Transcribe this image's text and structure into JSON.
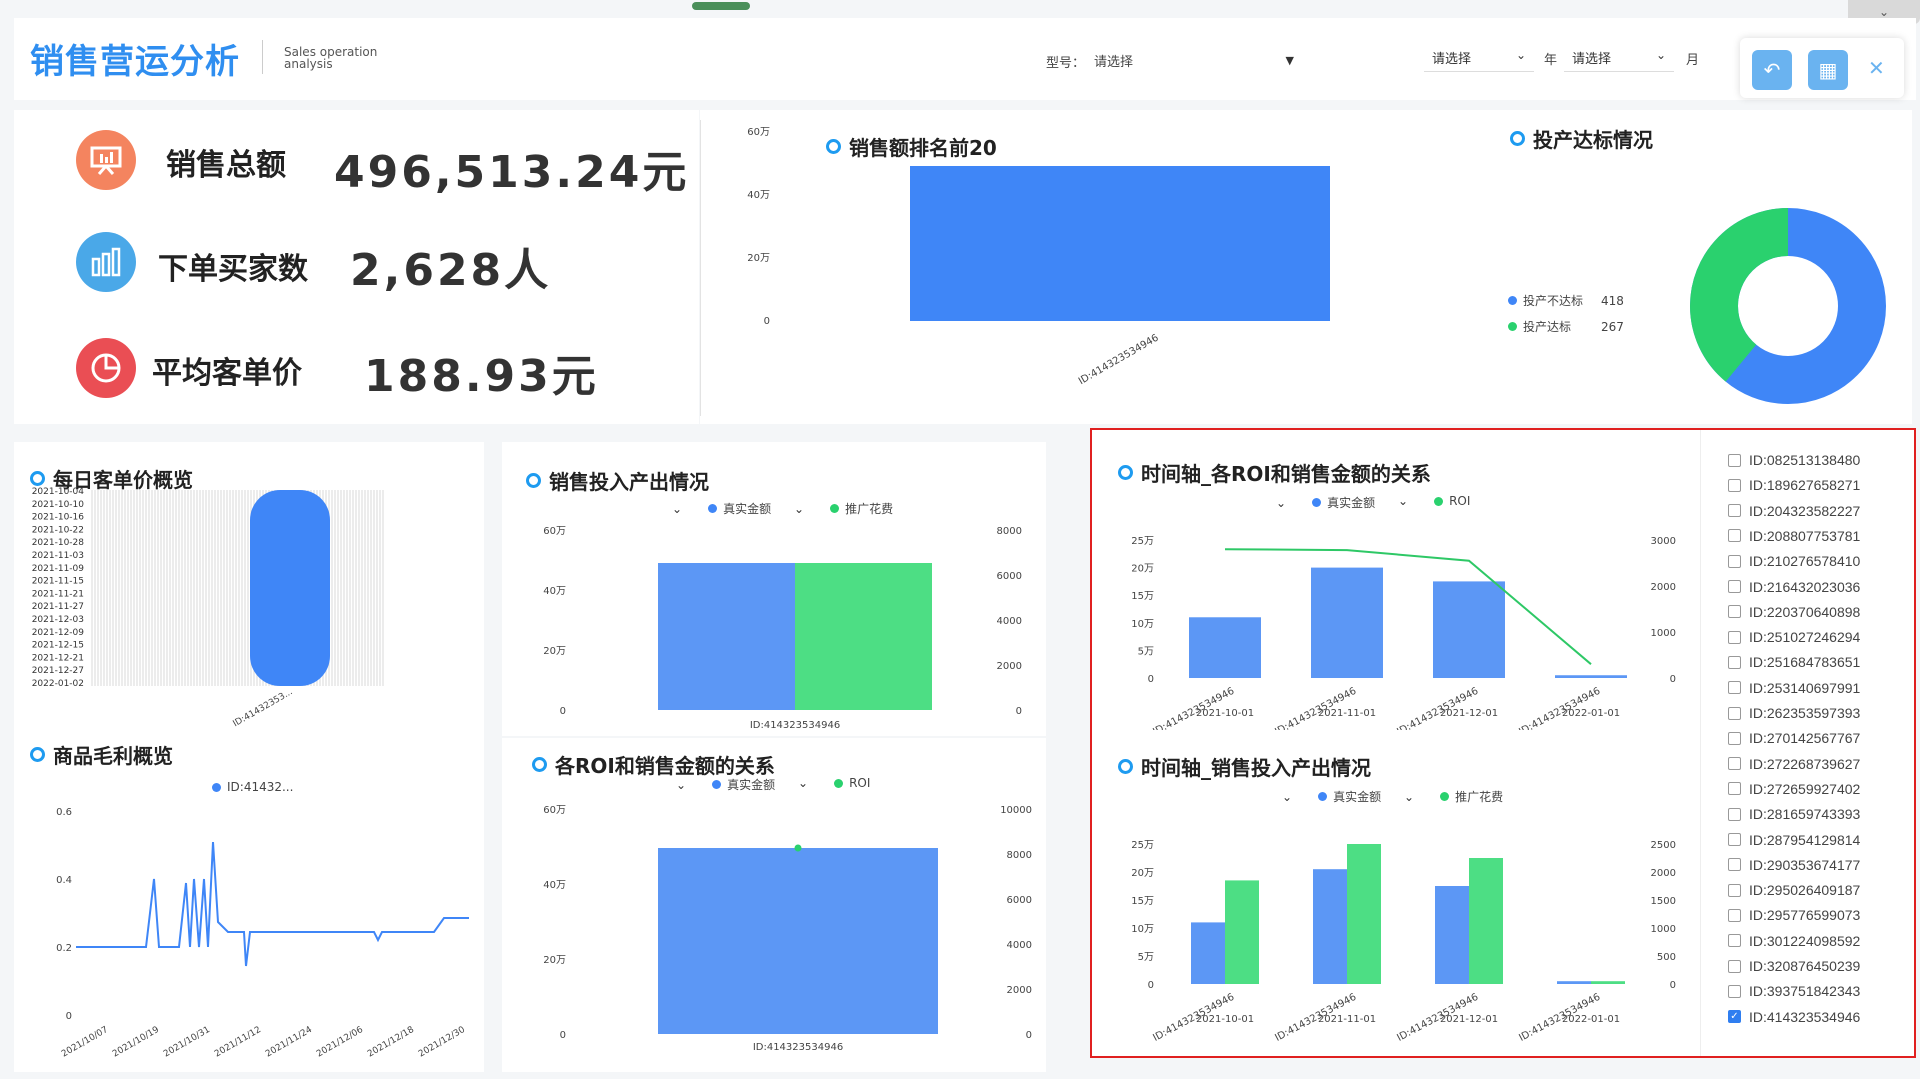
{
  "header": {
    "title": "销售营运分析",
    "subtitle_line1": "Sales operation",
    "subtitle_line2": "analysis",
    "model_label": "型号：",
    "model_value": "请选择",
    "year_select": "请选择",
    "year_label": "年",
    "month_select": "请选择",
    "month_label": "月"
  },
  "kpis": [
    {
      "label": "销售总额",
      "value": "496,513.24元",
      "icon": "presentation-icon",
      "color": "#f4845f"
    },
    {
      "label": "下单买家数",
      "value": "2,628人",
      "icon": "bar-chart-icon",
      "color": "#4aa8e8"
    },
    {
      "label": "平均客单价",
      "value": "188.93元",
      "icon": "pie-chart-icon",
      "color": "#ea4e54"
    }
  ],
  "colors": {
    "blue": "#3f86f7",
    "green": "#2ad16e",
    "line_green": "#2ec866",
    "accent": "#1e9bf0",
    "highlight_border": "#e02020"
  },
  "charts": {
    "top20": {
      "title": "销售额排名前20",
      "yticks": [
        "60万",
        "40万",
        "20万",
        "0"
      ],
      "xtick": "ID:414323534946"
    },
    "roi_pie": {
      "title": "投产达标情况",
      "legend": [
        {
          "name": "投产不达标",
          "value": "418"
        },
        {
          "name": "投产达标",
          "value": "267"
        }
      ]
    },
    "daily_unit": {
      "title": "每日客单价概览",
      "dates": [
        "2021-10-04",
        "2021-10-10",
        "2021-10-16",
        "2021-10-22",
        "2021-10-28",
        "2021-11-03",
        "2021-11-09",
        "2021-11-15",
        "2021-11-21",
        "2021-11-27",
        "2021-12-03",
        "2021-12-09",
        "2021-12-15",
        "2021-12-21",
        "2021-12-27",
        "2022-01-02"
      ],
      "xtick": "ID:41432353..."
    },
    "margin": {
      "title": "商品毛利概览",
      "legend": "ID:41432...",
      "yticks": [
        "0.6",
        "0.4",
        "0.2",
        "0"
      ],
      "xticks": [
        "2021/10/07",
        "2021/10/19",
        "2021/10/31",
        "2021/11/12",
        "2021/11/24",
        "2021/12/06",
        "2021/12/18",
        "2021/12/30"
      ]
    },
    "input_output": {
      "title": "销售投入产出情况",
      "legend": [
        "真实金额",
        "推广花费"
      ],
      "yticks_left": [
        "60万",
        "40万",
        "20万",
        "0"
      ],
      "yticks_right": [
        "8000",
        "6000",
        "4000",
        "2000",
        "0"
      ],
      "xtick": "ID:414323534946"
    },
    "roi_sales": {
      "title": "各ROI和销售金额的关系",
      "legend": [
        "真实金额",
        "ROI"
      ],
      "yticks_left": [
        "60万",
        "40万",
        "20万",
        "0"
      ],
      "yticks_right": [
        "10000",
        "8000",
        "6000",
        "4000",
        "2000",
        "0"
      ],
      "xtick": "ID:414323534946"
    },
    "timeline_roi": {
      "title": "时间轴_各ROI和销售金额的关系",
      "legend": [
        "真实金额",
        "ROI"
      ],
      "yticks_left": [
        "25万",
        "20万",
        "15万",
        "10万",
        "5万",
        "0"
      ],
      "yticks_right": [
        "3000",
        "2000",
        "1000",
        "0"
      ],
      "xtick_id": "ID:414323534946",
      "xdates": [
        "2021-10-01",
        "2021-11-01",
        "2021-12-01",
        "2022-01-01"
      ]
    },
    "timeline_io": {
      "title": "时间轴_销售投入产出情况",
      "legend": [
        "真实金额",
        "推广花费"
      ],
      "yticks_left": [
        "25万",
        "20万",
        "15万",
        "10万",
        "5万",
        "0"
      ],
      "yticks_right": [
        "2500",
        "2000",
        "1500",
        "1000",
        "500",
        "0"
      ],
      "xtick_id": "ID:414323534946",
      "xdates": [
        "2021-10-01",
        "2021-11-01",
        "2021-12-01",
        "2022-01-01"
      ]
    }
  },
  "chart_data": [
    {
      "type": "bar",
      "title": "销售额排名前20",
      "categories": [
        "ID:414323534946"
      ],
      "values": [
        500000
      ],
      "ylim": [
        0,
        600000
      ]
    },
    {
      "type": "pie",
      "title": "投产达标情况",
      "labels": [
        "投产不达标",
        "投产达标"
      ],
      "values": [
        418,
        267
      ]
    },
    {
      "type": "bar",
      "title": "销售投入产出情况",
      "categories": [
        "ID:414323534946"
      ],
      "series": [
        {
          "name": "真实金额",
          "values": [
            500000
          ]
        },
        {
          "name": "推广花费",
          "values": [
            6600
          ]
        }
      ]
    },
    {
      "type": "bar",
      "title": "各ROI和销售金额的关系",
      "categories": [
        "ID:414323534946"
      ],
      "series": [
        {
          "name": "真实金额",
          "values": [
            500000
          ]
        },
        {
          "name": "ROI",
          "values": [
            8000
          ]
        }
      ]
    },
    {
      "type": "bar",
      "title": "时间轴_各ROI和销售金额的关系",
      "categories": [
        "2021-10-01",
        "2021-11-01",
        "2021-12-01",
        "2022-01-01"
      ],
      "series": [
        {
          "name": "真实金额",
          "values": [
            110000,
            200000,
            175000,
            5000
          ]
        },
        {
          "name": "ROI",
          "values": [
            2800,
            2780,
            2550,
            300
          ]
        }
      ]
    },
    {
      "type": "bar",
      "title": "时间轴_销售投入产出情况",
      "categories": [
        "2021-10-01",
        "2021-11-01",
        "2021-12-01",
        "2022-01-01"
      ],
      "series": [
        {
          "name": "真实金额",
          "values": [
            110000,
            205000,
            175000,
            5000
          ]
        },
        {
          "name": "推广花费",
          "values": [
            1850,
            2500,
            2250,
            50
          ]
        }
      ]
    },
    {
      "type": "line",
      "title": "商品毛利概览",
      "x": [
        "2021/10/07",
        "2021/10/19",
        "2021/10/31",
        "2021/11/12",
        "2021/11/24",
        "2021/12/06",
        "2021/12/18",
        "2021/12/30"
      ],
      "values": [
        0.22,
        0.22,
        0.22,
        0.24,
        0.18,
        0.24,
        0.24,
        0.29
      ],
      "ylim": [
        0,
        0.6
      ]
    }
  ],
  "toolbar": {
    "back_icon": "undo-icon",
    "layout_icon": "layout-icon",
    "close_icon": "close-icon"
  },
  "id_list": [
    {
      "label": "ID:082513138480",
      "checked": false
    },
    {
      "label": "ID:189627658271",
      "checked": false
    },
    {
      "label": "ID:204323582227",
      "checked": false
    },
    {
      "label": "ID:208807753781",
      "checked": false
    },
    {
      "label": "ID:210276578410",
      "checked": false
    },
    {
      "label": "ID:216432023036",
      "checked": false
    },
    {
      "label": "ID:220370640898",
      "checked": false
    },
    {
      "label": "ID:251027246294",
      "checked": false
    },
    {
      "label": "ID:251684783651",
      "checked": false
    },
    {
      "label": "ID:253140697991",
      "checked": false
    },
    {
      "label": "ID:262353597393",
      "checked": false
    },
    {
      "label": "ID:270142567767",
      "checked": false
    },
    {
      "label": "ID:272268739627",
      "checked": false
    },
    {
      "label": "ID:272659927402",
      "checked": false
    },
    {
      "label": "ID:281659743393",
      "checked": false
    },
    {
      "label": "ID:287954129814",
      "checked": false
    },
    {
      "label": "ID:290353674177",
      "checked": false
    },
    {
      "label": "ID:295026409187",
      "checked": false
    },
    {
      "label": "ID:295776599073",
      "checked": false
    },
    {
      "label": "ID:301224098592",
      "checked": false
    },
    {
      "label": "ID:320876450239",
      "checked": false
    },
    {
      "label": "ID:393751842343",
      "checked": false
    },
    {
      "label": "ID:414323534946",
      "checked": true
    }
  ]
}
